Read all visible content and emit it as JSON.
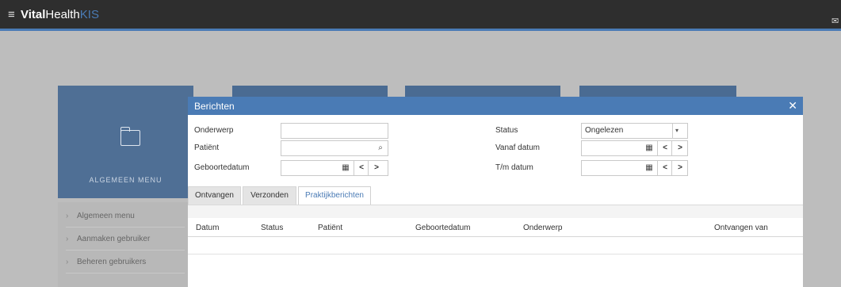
{
  "app": {
    "menu_icon": "≡",
    "brand_bold": "Vital",
    "brand_mid": "Health",
    "brand_accent": "KIS",
    "accent_color": "#4a7bb5",
    "mail_icon": "✉"
  },
  "tiles": {
    "main_caption": "ALGEMEEN MENU"
  },
  "sidebar": {
    "items": [
      {
        "label": "Algemeen menu"
      },
      {
        "label": "Aanmaken gebruiker"
      },
      {
        "label": "Beheren gebruikers"
      }
    ],
    "chevron": "›"
  },
  "dialog": {
    "title": "Berichten",
    "close": "✕",
    "fields": {
      "onderwerp": {
        "label": "Onderwerp",
        "value": ""
      },
      "patient": {
        "label": "Patiënt",
        "value": "",
        "icon": "⌕"
      },
      "geboortedatum": {
        "label": "Geboortedatum",
        "value": ""
      },
      "status": {
        "label": "Status",
        "value": "Ongelezen",
        "caret": "▾"
      },
      "vanaf": {
        "label": "Vanaf datum",
        "value": ""
      },
      "tm": {
        "label": "T/m datum",
        "value": ""
      }
    },
    "cal_icon": "▦",
    "prev": "<",
    "next": ">",
    "tabs": [
      {
        "label": "Ontvangen"
      },
      {
        "label": "Verzonden"
      },
      {
        "label": "Praktijkberichten"
      }
    ],
    "active_tab": "Praktijkberichten",
    "columns": [
      "Datum",
      "Status",
      "Patiënt",
      "Geboortedatum",
      "Onderwerp",
      "Ontvangen van"
    ]
  }
}
